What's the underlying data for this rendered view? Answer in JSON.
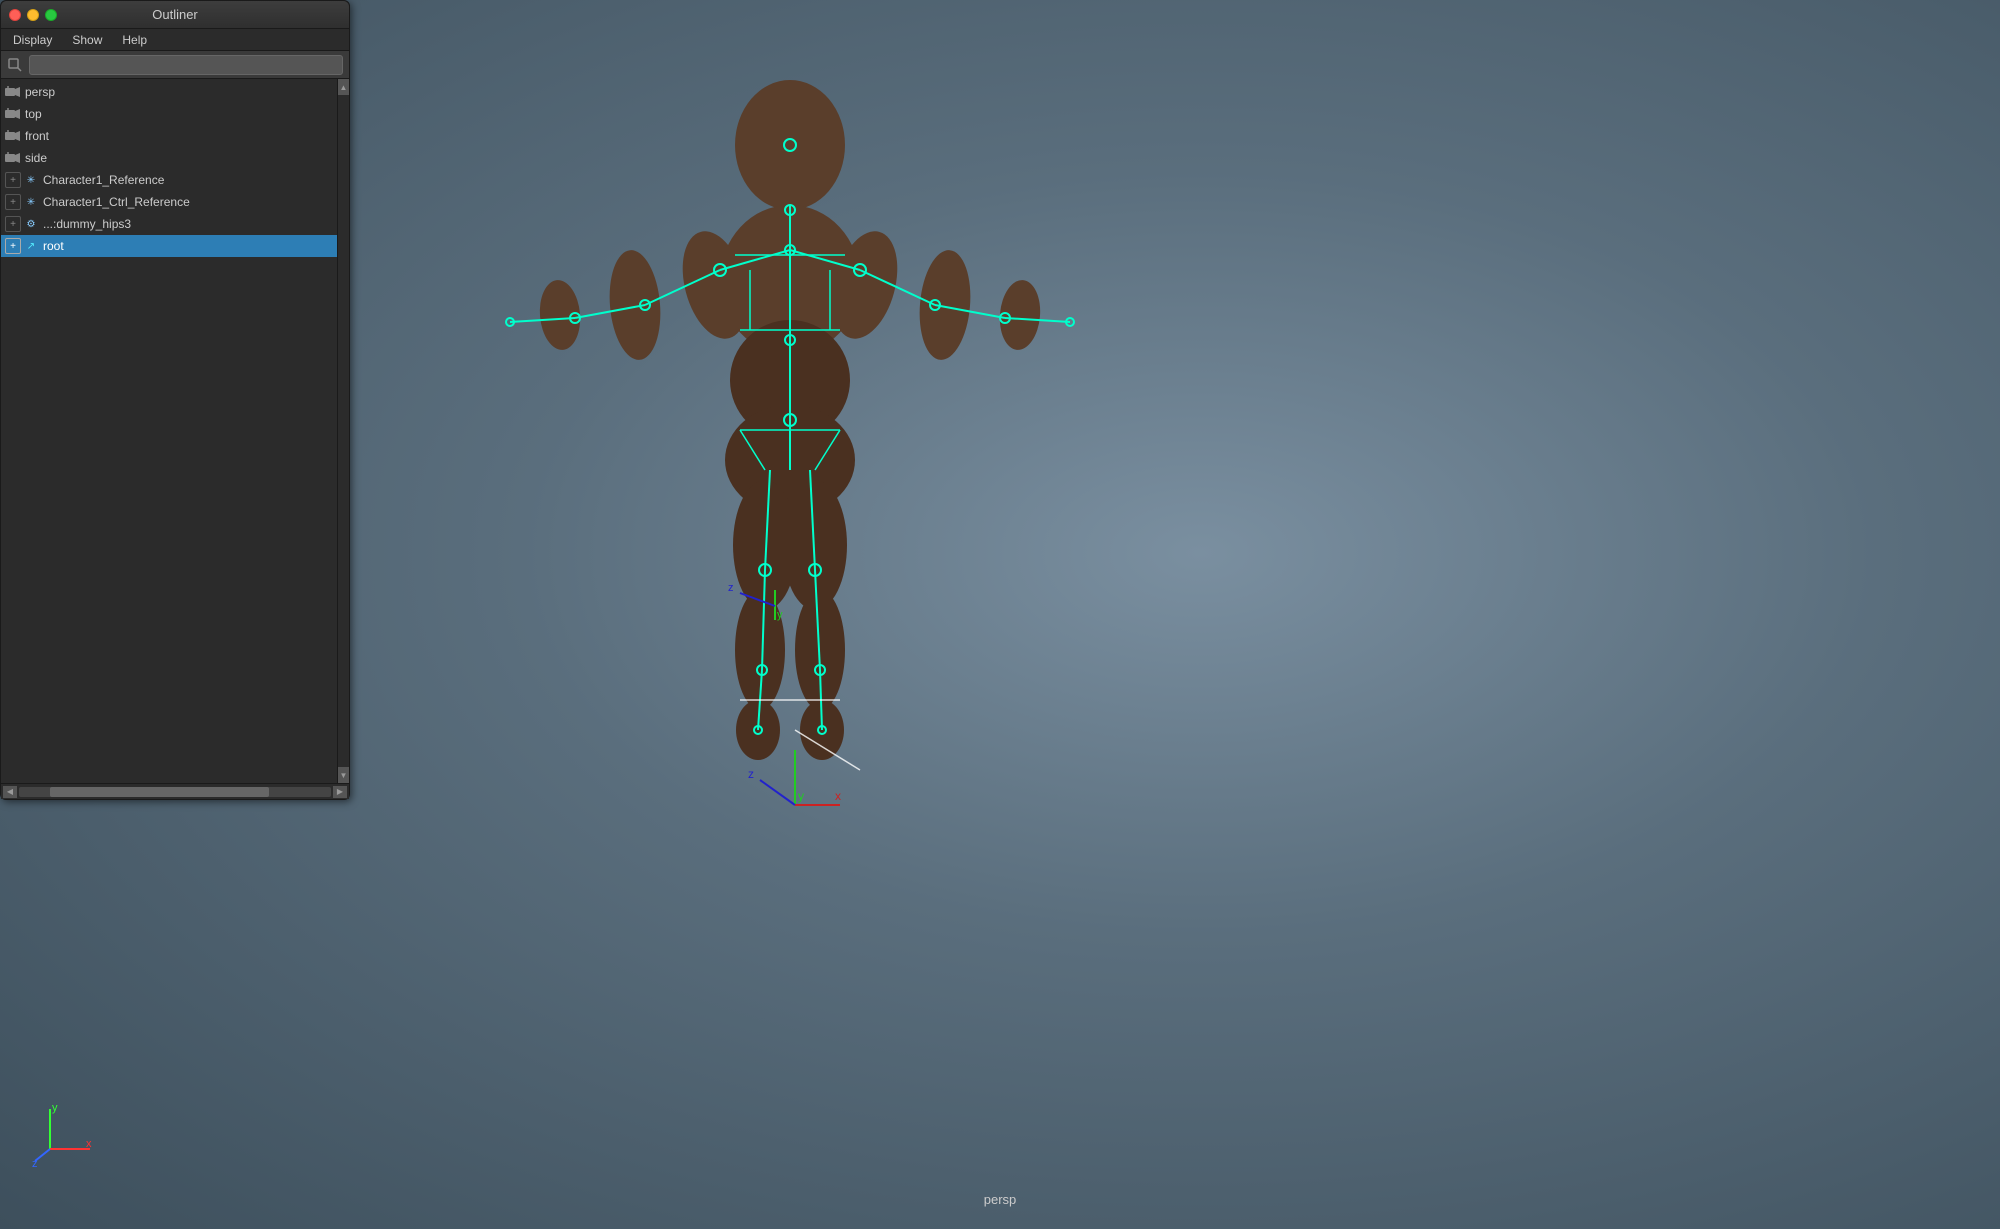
{
  "app": {
    "title": "Outliner",
    "camera_label": "persp"
  },
  "menu": {
    "items": [
      "Display",
      "Show",
      "Help"
    ]
  },
  "search": {
    "placeholder": ""
  },
  "tree": {
    "items": [
      {
        "id": "persp",
        "label": "persp",
        "type": "camera",
        "indent": 0,
        "expandable": false,
        "selected": false
      },
      {
        "id": "top",
        "label": "top",
        "type": "camera",
        "indent": 0,
        "expandable": false,
        "selected": false
      },
      {
        "id": "front",
        "label": "front",
        "type": "camera",
        "indent": 0,
        "expandable": false,
        "selected": false
      },
      {
        "id": "side",
        "label": "side",
        "type": "camera",
        "indent": 0,
        "expandable": false,
        "selected": false
      },
      {
        "id": "char1ref",
        "label": "Character1_Reference",
        "type": "reference",
        "indent": 0,
        "expandable": true,
        "selected": false
      },
      {
        "id": "char1ctrlref",
        "label": "Character1_Ctrl_Reference",
        "type": "reference",
        "indent": 0,
        "expandable": true,
        "selected": false
      },
      {
        "id": "dummyhips",
        "label": "...:dummy_hips3",
        "type": "hips",
        "indent": 0,
        "expandable": true,
        "selected": false
      },
      {
        "id": "root",
        "label": "root",
        "type": "root",
        "indent": 0,
        "expandable": true,
        "selected": true
      }
    ]
  },
  "icons": {
    "camera": "🎥",
    "expand_plus": "+",
    "expand_minus": "-",
    "reference_star": "✳",
    "hips_gear": "⚙",
    "root_arrow": "↗"
  },
  "colors": {
    "selected_bg": "#2d7eb5",
    "skeleton_color": "#00ffcc",
    "axis_x": "#ff3333",
    "axis_y": "#33ff33",
    "axis_z": "#3333ff"
  }
}
